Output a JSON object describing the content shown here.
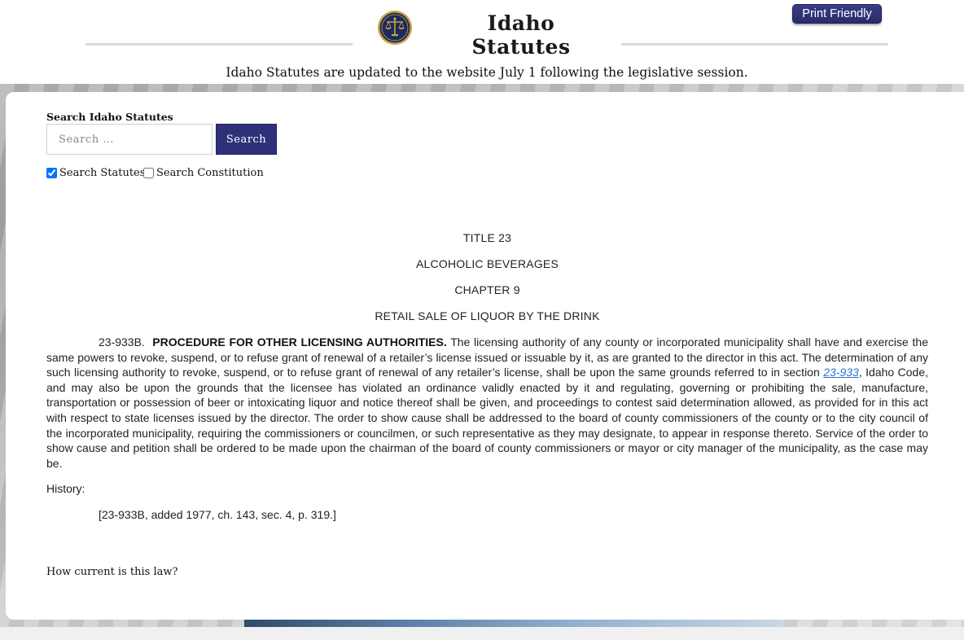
{
  "header": {
    "site_title": "Idaho Statutes",
    "print_button": "Print Friendly",
    "update_note": "Idaho Statutes are updated to the website July 1 following the legislative session."
  },
  "search": {
    "label": "Search Idaho Statutes",
    "placeholder": "Search …",
    "button": "Search",
    "options": [
      {
        "label": "Search Statutes",
        "checked": true
      },
      {
        "label": "Search Constitution",
        "checked": false
      }
    ]
  },
  "statute": {
    "title": "TITLE 23",
    "title_name": "ALCOHOLIC BEVERAGES",
    "chapter": "CHAPTER 9",
    "chapter_name": "RETAIL SALE OF LIQUOR BY THE DRINK",
    "section_number": "23-933B.",
    "section_heading": "PROCEDURE FOR OTHER LICENSING AUTHORITIES.",
    "text_part1": "The licensing authority of any county or incorporated municipality shall have and exercise the same powers to revoke, suspend, or to refuse grant of renewal of a retailer’s license issued or issuable by it, as are granted to the director in this act. The determination of any such licensing authority to revoke, suspend, or to refuse grant of renewal of any retailer’s license, shall be upon the same grounds referred to in section ",
    "link_text": "23-933",
    "text_part2": ", Idaho Code, and may also be upon the grounds that the licensee has violated an ordinance validly enacted by it and regulating, governing or prohibiting the sale, manufacture, transportation or possession of beer or intoxicating liquor and notice thereof shall be given, and proceedings to contest said determination allowed, as provided for in this act with respect to state licenses issued by the director. The order to show cause shall be addressed to the board of county commissioners of the county or to the city council of the incorporated municipality, requiring the commissioners or councilmen, or such representative as they may designate, to appear in response thereto. Service of the order to show cause and petition shall be ordered to be made upon the chairman of the board of county commissioners or mayor or city manager of the municipality, as the case may be.",
    "history_label": "History:",
    "history_entry": "[23-933B, added 1977, ch. 143, sec. 4, p. 319.]"
  },
  "footer": {
    "current_link": "How current is this law?"
  },
  "colors": {
    "button_navy": "#2e3179",
    "link_blue": "#2f6fd6",
    "seal_gold": "#c9a642"
  }
}
